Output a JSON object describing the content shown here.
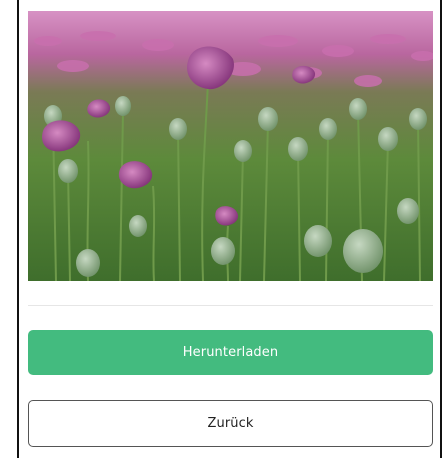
{
  "image": {
    "subject": "poppy-field",
    "colors": {
      "sky_blossoms": "#c36fa8",
      "blossom": "#9d3f8c",
      "foliage": "#5e8a3c",
      "pods": "#8fb08a"
    }
  },
  "actions": {
    "download_label": "Herunterladen",
    "back_label": "Zurück"
  },
  "colors": {
    "accent": "#43bb7f",
    "border": "#555555"
  }
}
